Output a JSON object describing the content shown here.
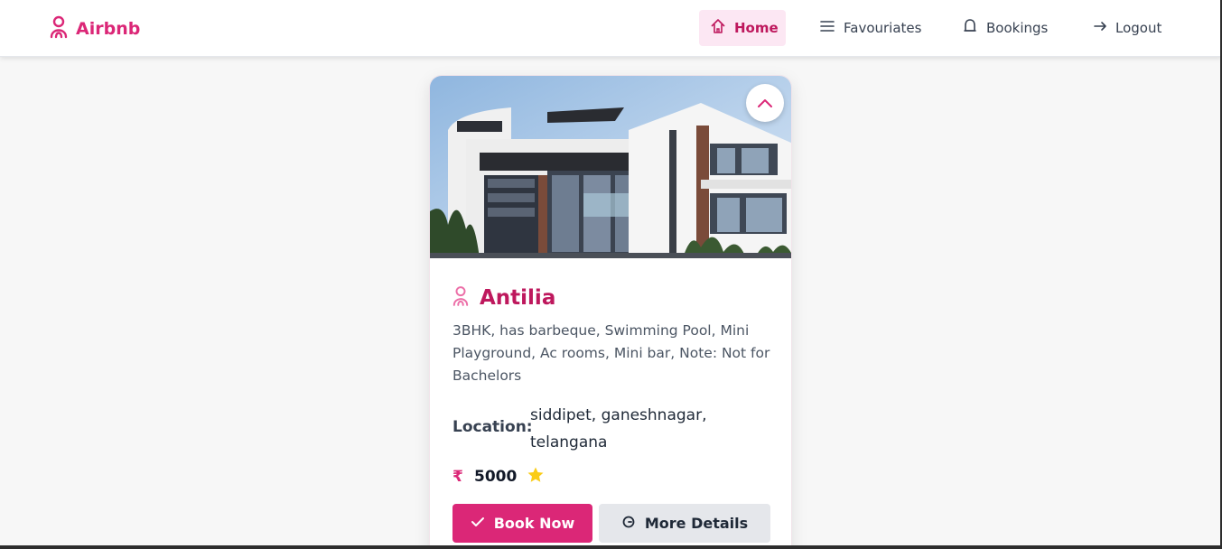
{
  "brand": {
    "name": "Airbnb",
    "icon": "airbnb-logo-icon",
    "color": "#db2777"
  },
  "nav": {
    "items": [
      {
        "label": "Home",
        "icon": "home-icon",
        "active": true
      },
      {
        "label": "Favouriates",
        "icon": "menu-lines-icon",
        "active": false
      },
      {
        "label": "Bookings",
        "icon": "bell-icon",
        "active": false
      },
      {
        "label": "Logout",
        "icon": "arrow-right-icon",
        "active": false
      }
    ]
  },
  "listing": {
    "image_alt": "modern-house-photo",
    "title": "Antilia",
    "description": "3BHK, has barbeque, Swimming Pool, Mini Playground, Ac rooms, Mini bar, Note: Not for Bachelors",
    "location_label": "Location:",
    "location_value": "siddipet, ganeshnagar, telangana",
    "currency_symbol": "₹",
    "price": "5000",
    "rating_icon": "star-icon",
    "book_label": "Book Now",
    "details_label": "More Details"
  },
  "colors": {
    "accent": "#db2777",
    "accent_dark": "#be185d",
    "active_bg": "#fce7f3",
    "star": "#facc15"
  }
}
